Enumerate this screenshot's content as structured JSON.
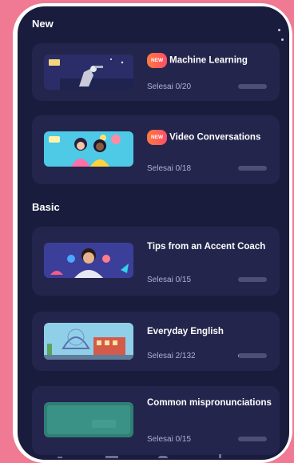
{
  "sections": [
    {
      "title": "New",
      "items": [
        {
          "badge": "NEW",
          "title": "Machine Learning",
          "progress_label": "Selesai 0/20",
          "done": 0,
          "total": 20,
          "thumb": "robot-hand-illustration"
        },
        {
          "badge": "NEW",
          "title": "Video Conversations",
          "progress_label": "Selesai 0/18",
          "done": 0,
          "total": 18,
          "thumb": "two-people-chatting-illustration"
        }
      ]
    },
    {
      "title": "Basic",
      "items": [
        {
          "badge": "",
          "title": "Tips from an Accent Coach",
          "progress_label": "Selesai 0/15",
          "done": 0,
          "total": 15,
          "thumb": "coach-portrait-illustration"
        },
        {
          "badge": "",
          "title": "Everyday English",
          "progress_label": "Selesai 2/132",
          "done": 2,
          "total": 132,
          "thumb": "city-street-illustration"
        },
        {
          "badge": "",
          "title": "Common mispronunciations",
          "progress_label": "Selesai 0/15",
          "done": 0,
          "total": 15,
          "thumb": "green-chalkboard-illustration"
        }
      ]
    }
  ],
  "colors": {
    "background": "#f07a93",
    "screen": "#1a1c3d",
    "card": "#23254c",
    "badge": "#ff5a55"
  }
}
